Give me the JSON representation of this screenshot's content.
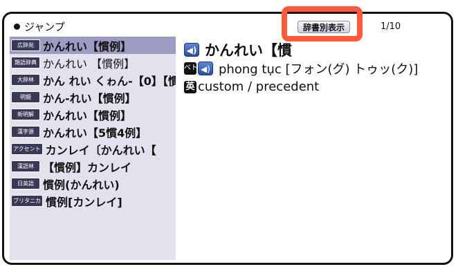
{
  "header": {
    "jump_label": "ジャンプ",
    "dict_button_label": "辞書別表示",
    "page_indicator": "1/10"
  },
  "sidebar": {
    "items": [
      {
        "tag": "広辞苑",
        "text": "かんれい【慣例】",
        "selected": true
      },
      {
        "tag": "類語辞典",
        "text": "かんれい 【慣例】",
        "selected": false
      },
      {
        "tag": "大辞林",
        "text": "かん れい くゎん-【0】【慣",
        "selected": false
      },
      {
        "tag": "明鏡",
        "text": "かん-れい【慣例】",
        "selected": false
      },
      {
        "tag": "新明解",
        "text": "かんれい【慣例】",
        "selected": false
      },
      {
        "tag": "漢字源",
        "text": "かんれい【5慣4例】",
        "selected": false
      },
      {
        "tag": "アクセント",
        "text": "カンレイ〔かんれい【",
        "selected": false
      },
      {
        "tag": "漢語林",
        "text": "【慣例】カンレイ",
        "selected": false
      },
      {
        "tag": "日英語",
        "text": "慣例(かんれい)",
        "selected": false
      },
      {
        "tag": "ブリタニカ",
        "text": "慣例[カンレイ]",
        "selected": false
      }
    ]
  },
  "main": {
    "headword": "かんれい【慣",
    "viet_tag": "ベト",
    "viet_text": "phong tục [フォン(グ) トゥッ(ク)]",
    "en_tag": "英",
    "en_text": "custom / precedent"
  }
}
